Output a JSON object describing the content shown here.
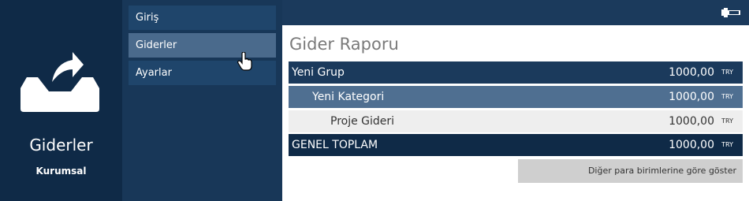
{
  "brand": {
    "title": "Giderler",
    "subtitle": "Kurumsal",
    "icon": "inbox-export-icon"
  },
  "nav": {
    "items": [
      {
        "label": "Giriş",
        "active": false
      },
      {
        "label": "Giderler",
        "active": true
      },
      {
        "label": "Ayarlar",
        "active": false
      }
    ]
  },
  "topbar": {
    "icon": "plug-icon"
  },
  "report": {
    "title": "Gider Raporu",
    "rows": [
      {
        "label": "Yeni Grup",
        "amount": "1000,00",
        "currency": "TRY"
      },
      {
        "label": "Yeni Kategori",
        "amount": "1000,00",
        "currency": "TRY"
      },
      {
        "label": "Proje Gideri",
        "amount": "1000,00",
        "currency": "TRY"
      },
      {
        "label": "GENEL TOPLAM",
        "amount": "1000,00",
        "currency": "TRY"
      }
    ],
    "show_other_label": "Diğer para birimlerine göre göster"
  },
  "colors": {
    "brand_bg": "#0f2a47",
    "nav_bg": "#183758",
    "nav_active": "#4a6a8c",
    "group_row": "#1b3a5c",
    "category_row": "#4f6f91",
    "item_row": "#eeeeee",
    "total_row": "#0f2a47"
  }
}
